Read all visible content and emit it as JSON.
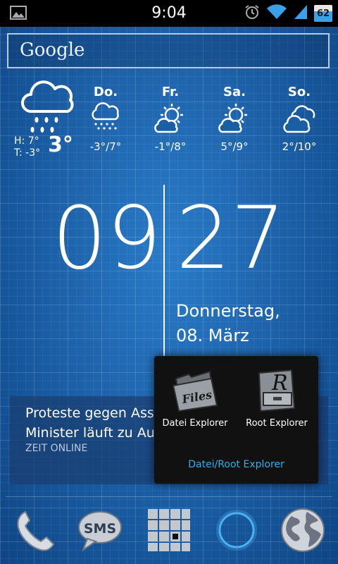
{
  "status_bar": {
    "time": "9:04",
    "battery": "62",
    "battery_level": 0.62
  },
  "search": {
    "logo": "Google"
  },
  "weather": {
    "current": {
      "high": "H: 7°",
      "low": "T: -3°",
      "temp": "3°",
      "icon": "rain-cloud-icon"
    },
    "forecast": [
      {
        "day": "Do.",
        "temps": "-3°/7°",
        "icon": "snow-cloud-icon"
      },
      {
        "day": "Fr.",
        "temps": "-1°/8°",
        "icon": "sun-cloud-icon"
      },
      {
        "day": "Sa.",
        "temps": "5°/9°",
        "icon": "sun-cloud-icon"
      },
      {
        "day": "So.",
        "temps": "2°/10°",
        "icon": "cloud-icon"
      }
    ]
  },
  "clock": {
    "hours": "09",
    "minutes": "27",
    "weekday": "Donnerstag,",
    "date": "08. März"
  },
  "news": {
    "line1": "Proteste gegen Assa",
    "line2": "Minister läuft zu Au",
    "source": "ZEIT ONLINE"
  },
  "popup": {
    "apps": [
      {
        "label": "Datei Explorer",
        "icon_text": "Files"
      },
      {
        "label": "Root Explorer",
        "icon_text": "R"
      }
    ],
    "title": "Datei/Root Explorer"
  },
  "dock": {
    "sms_label": "SMS"
  },
  "colors": {
    "accent": "#33aee8",
    "background": "#1a5ea6",
    "statusbar": "#000000"
  }
}
